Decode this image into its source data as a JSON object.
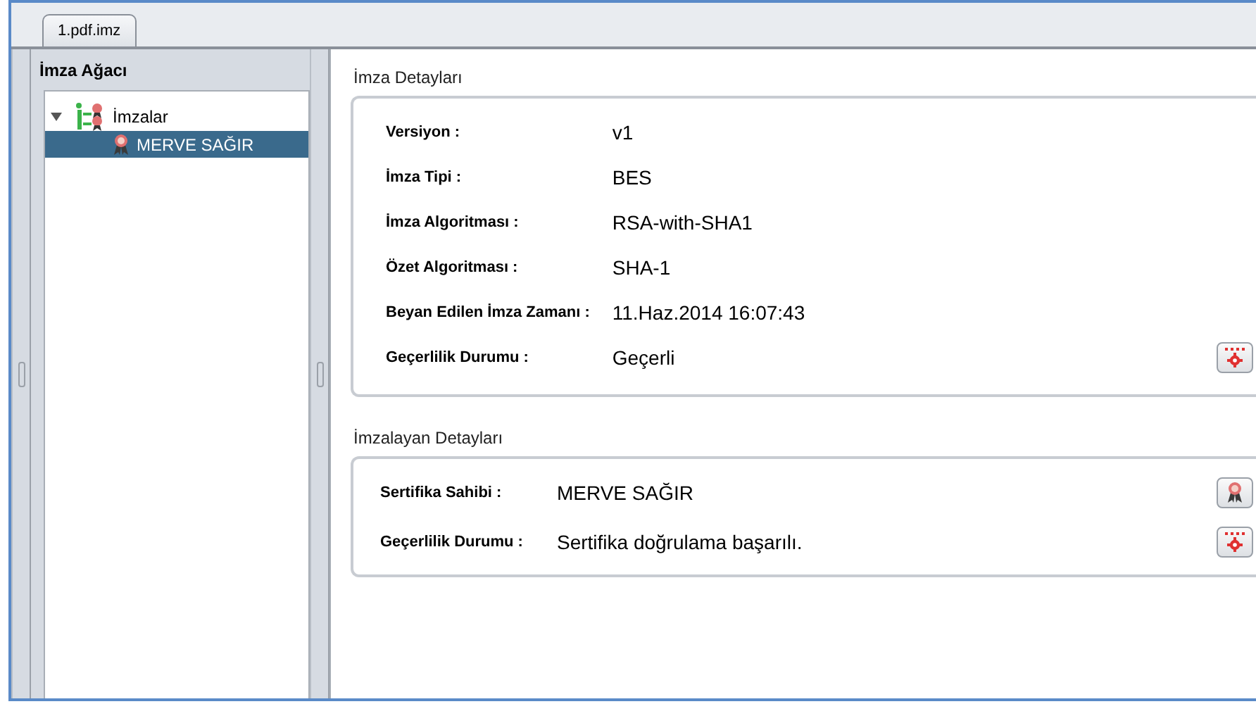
{
  "tab": {
    "label": "1.pdf.imz",
    "selected": true
  },
  "tree": {
    "title": "İmza Ağacı",
    "items": [
      {
        "label": "İmzalar",
        "kind": "group",
        "expanded": true,
        "selected": false,
        "children": [
          {
            "label": "MERVE SAĞIR",
            "kind": "signature",
            "selected": true
          }
        ]
      }
    ]
  },
  "sections": [
    {
      "title": "İmza Detayları",
      "rows": [
        {
          "label": "Versiyon :",
          "value": "v1"
        },
        {
          "label": "İmza Tipi :",
          "value": "BES"
        },
        {
          "label": "İmza Algoritması :",
          "value": "RSA-with-SHA1"
        },
        {
          "label": "Özet Algoritması :",
          "value": "SHA-1"
        },
        {
          "label": "Beyan Edilen İmza Zamanı :",
          "value": "11.Haz.2014 16:07:43"
        },
        {
          "label": "Geçerlilik Durumu :",
          "value": "Geçerli",
          "button": {
            "kind": "validate"
          }
        }
      ]
    },
    {
      "title": "İmzalayan Detayları",
      "rows": [
        {
          "label": "Sertifika Sahibi :",
          "value": "MERVE SAĞIR",
          "button": {
            "kind": "certificate"
          }
        },
        {
          "label": "Geçerlilik Durumu :",
          "value": "Sertifika doğrulama başarılı.",
          "button": {
            "kind": "validate"
          }
        }
      ]
    }
  ]
}
